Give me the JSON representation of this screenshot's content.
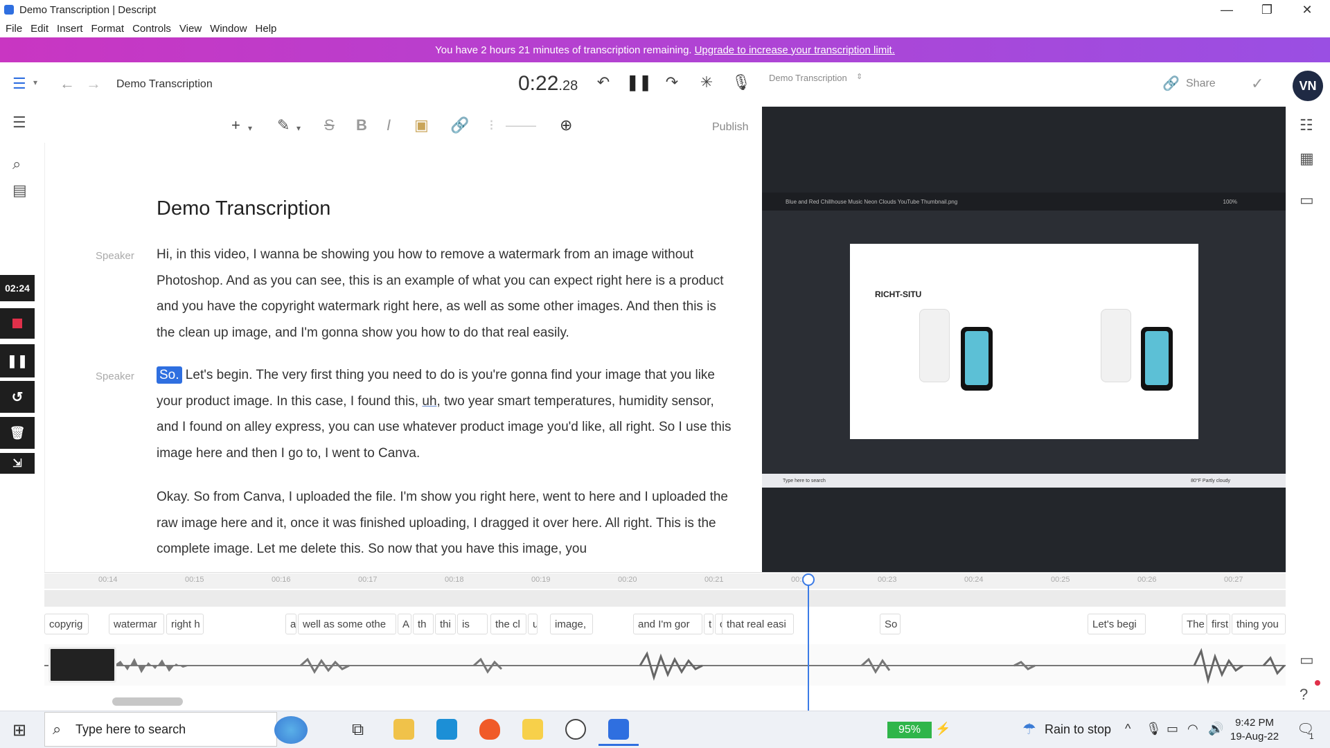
{
  "window": {
    "title": "Demo Transcription | Descript",
    "minimize": "—",
    "restore": "❐",
    "close": "✕"
  },
  "menu": [
    "File",
    "Edit",
    "Insert",
    "Format",
    "Controls",
    "View",
    "Window",
    "Help"
  ],
  "banner": {
    "text": "You have 2 hours 21 minutes of transcription remaining.",
    "link": "Upgrade to increase your transcription limit."
  },
  "toolbar": {
    "doc_name": "Demo Transcription",
    "time_main": "0:22",
    "time_frac": ".28",
    "composition": "Demo Transcription",
    "share_label": "Share",
    "avatar": "VN"
  },
  "editor": {
    "publish_label": "Publish",
    "doc_title": "Demo Transcription",
    "paragraphs": [
      {
        "speaker": "Speaker",
        "text": "Hi, in this video, I wanna be showing you how to remove a watermark from an image without Photoshop. And as you can see, this is an example of what you can expect right here is a product and you have the copyright watermark right here, as well as some other images. And then this is the clean up image, and I'm gonna show you how to do that real easily."
      },
      {
        "speaker": "Speaker",
        "highlight": "So.",
        "text_a": " Let's begin. The very first thing you need to do is you're gonna find your image that you like your product image. In this case, I found this, ",
        "filler": "uh",
        "text_b": ", two year smart temperatures, humidity sensor, and I found on alley express, you can use whatever product image you'd like, all right. So I use this image here and then I go to, I went to Canva."
      },
      {
        "speaker": "",
        "text": "Okay. So from Canva, I uploaded the file. I'm show you right here, went to here and I uploaded the raw image here and it, once it was finished uploading, I dragged it over here. All right. This is the complete image. Let me delete this. So now that you have this image, you"
      }
    ]
  },
  "recorder": {
    "time": "02:24"
  },
  "video": {
    "tab_title": "Blue and Red Chillhouse Music Neon Clouds YouTube Thumbnail.png",
    "zoom": "100%",
    "brand": "RICHT-SITU",
    "taskbar_search": "Type here to search",
    "taskbar_weather": "80°F Partly cloudy"
  },
  "timeline": {
    "ticks": [
      "00:14",
      "00:15",
      "00:16",
      "00:17",
      "00:18",
      "00:19",
      "00:20",
      "00:21",
      "00:22",
      "00:23",
      "00:24",
      "00:25",
      "00:26",
      "00:27"
    ],
    "words": [
      "copyrig",
      "watermar",
      "right h",
      "a",
      "well as some othe",
      "A",
      "th",
      "thi",
      "is",
      "the cl",
      "u",
      "image,",
      "and I'm gor",
      "t",
      "c",
      "that real easi",
      "So",
      "Let's begi",
      "The",
      "first",
      "thing you"
    ]
  },
  "taskbar": {
    "search_placeholder": "Type here to search",
    "battery": "95%",
    "weather": "Rain to stop",
    "time": "9:42 PM",
    "date": "19-Aug-22",
    "notifications": "1"
  }
}
